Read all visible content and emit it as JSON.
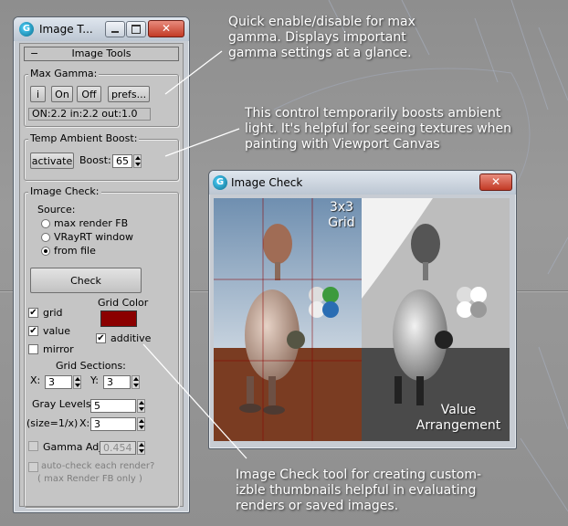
{
  "panel": {
    "title": "Image T...",
    "rollout_title": "Image Tools",
    "rollout_toggle": "−",
    "max_gamma": {
      "label": "Max Gamma:",
      "buttons": [
        "i",
        "On",
        "Off",
        "prefs..."
      ],
      "status": "ON:2.2  in:2.2  out:1.0"
    },
    "ambient": {
      "label": "Temp Ambient Boost:",
      "activate": "activate",
      "boost_label": "Boost:",
      "boost_value": "65"
    },
    "image_check": {
      "label": "Image Check:",
      "source_label": "Source:",
      "sources": [
        "max render FB",
        "VRayRT window",
        "from file"
      ],
      "selected_source": "from file",
      "check_button": "Check",
      "grid_label": "grid",
      "grid_checked": true,
      "value_label": "value",
      "value_checked": true,
      "mirror_label": "mirror",
      "mirror_checked": false,
      "grid_color_label": "Grid Color",
      "grid_color": "#8b0000",
      "additive_label": "additive",
      "additive_checked": true,
      "grid_sections_label": "Grid Sections:",
      "x_label": "X:",
      "x_value": "3",
      "y_label": "Y:",
      "y_value": "3",
      "gray_levels_label": "Gray Levels:",
      "gray_levels_value": "5",
      "size_label": "(size=1/x)",
      "size_x_label": "X:",
      "size_x_value": "3",
      "gamma_label": "Gamma Adj.",
      "gamma_value": "0.454",
      "autocheck_label": "auto-check each render?",
      "autocheck_note": "( max Render FB only )",
      "check_mark": "✔"
    }
  },
  "image_check_window": {
    "title": "Image Check",
    "grid_caption_1": "3x3",
    "grid_caption_2": "Grid",
    "value_caption_1": "Value",
    "value_caption_2": "Arrangement"
  },
  "annotations": {
    "gamma": [
      "Quick enable/disable for max",
      "gamma. Displays important",
      "gamma settings at a glance."
    ],
    "ambient": [
      "This control temporarily boosts ambient",
      "light. It's helpful for seeing textures when",
      "painting with Viewport Canvas"
    ],
    "image_check": [
      "Image Check tool for creating custom-",
      "izble thumbnails helpful in evaluating",
      "renders or saved images."
    ]
  },
  "colors": {
    "accent_close": "#c23a25",
    "annotation_text": "#ffffff"
  }
}
